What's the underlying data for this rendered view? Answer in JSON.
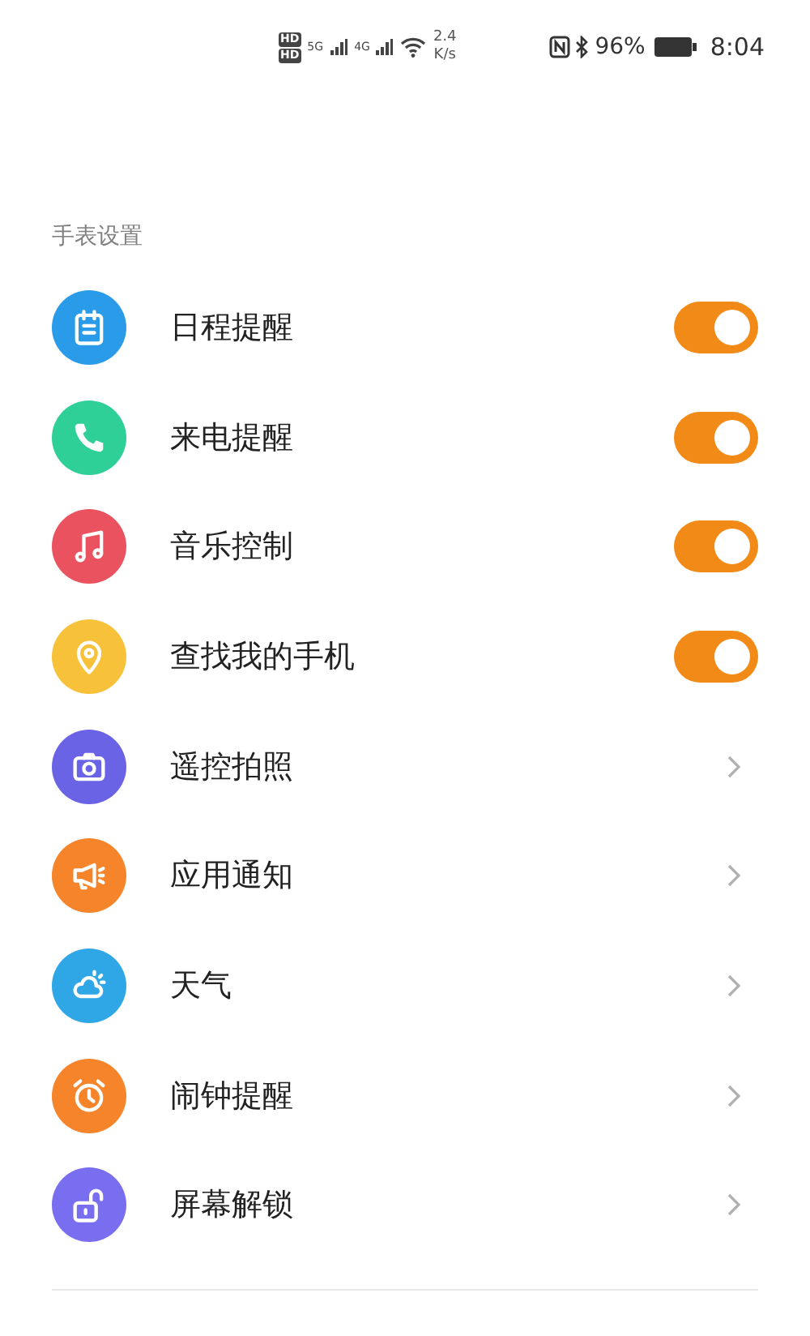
{
  "status_bar": {
    "hd_badges": [
      "HD",
      "HD"
    ],
    "networks": [
      "5G",
      "4G"
    ],
    "speed": "2.4",
    "speed_unit": "K/s",
    "battery": "96%",
    "time": "8:04"
  },
  "section_title": "手表设置",
  "items": [
    {
      "label": "日程提醒",
      "kind": "toggle",
      "on": true,
      "color": "#2a9be8"
    },
    {
      "label": "来电提醒",
      "kind": "toggle",
      "on": true,
      "color": "#2fcf98"
    },
    {
      "label": "音乐控制",
      "kind": "toggle",
      "on": true,
      "color": "#e9525e"
    },
    {
      "label": "查找我的手机",
      "kind": "toggle",
      "on": true,
      "color": "#f7c23a"
    },
    {
      "label": "遥控拍照",
      "kind": "link",
      "color": "#6b63e6"
    },
    {
      "label": "应用通知",
      "kind": "link",
      "color": "#f5842a"
    },
    {
      "label": "天气",
      "kind": "link",
      "color": "#2fa6e6"
    },
    {
      "label": "闹钟提醒",
      "kind": "link",
      "color": "#f6842a"
    },
    {
      "label": "屏幕解锁",
      "kind": "link",
      "color": "#7a6ef0"
    }
  ]
}
